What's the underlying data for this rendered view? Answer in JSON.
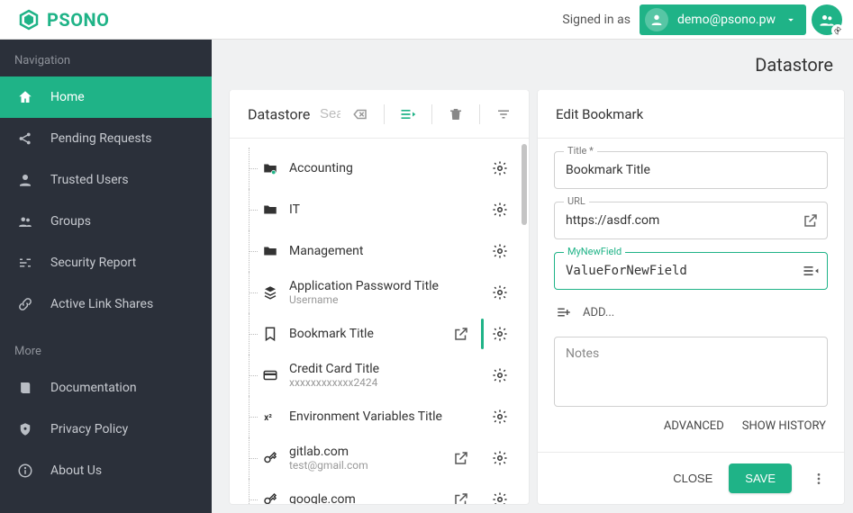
{
  "brand": {
    "name": "PSONO"
  },
  "header": {
    "signed_in_label": "Signed in as",
    "user_email": "demo@psono.pw"
  },
  "sidebar": {
    "heading_nav": "Navigation",
    "heading_more": "More",
    "nav": [
      {
        "label": "Home",
        "icon": "home",
        "active": true
      },
      {
        "label": "Pending Requests",
        "icon": "share"
      },
      {
        "label": "Trusted Users",
        "icon": "person"
      },
      {
        "label": "Groups",
        "icon": "group"
      },
      {
        "label": "Security Report",
        "icon": "equalizer"
      },
      {
        "label": "Active Link Shares",
        "icon": "link"
      }
    ],
    "more": [
      {
        "label": "Documentation",
        "icon": "book"
      },
      {
        "label": "Privacy Policy",
        "icon": "privacy"
      },
      {
        "label": "About Us",
        "icon": "info"
      }
    ]
  },
  "page": {
    "title": "Datastore"
  },
  "datastore": {
    "panel_title": "Datastore",
    "search_placeholder": "Search",
    "items": [
      {
        "title": "Accounting",
        "type": "folder-shared"
      },
      {
        "title": "IT",
        "type": "folder"
      },
      {
        "title": "Management",
        "type": "folder"
      },
      {
        "title": "Application Password Title",
        "subtitle": "Username",
        "type": "app"
      },
      {
        "title": "Bookmark Title",
        "type": "bookmark",
        "open_action": true,
        "selected": true
      },
      {
        "title": "Credit Card Title",
        "subtitle": "xxxxxxxxxxxx2424",
        "type": "card"
      },
      {
        "title": "Environment Variables Title",
        "type": "env"
      },
      {
        "title": "gitlab.com",
        "subtitle": "test@gmail.com",
        "type": "key",
        "open_action": true
      },
      {
        "title": "google.com",
        "type": "key",
        "open_action": true
      }
    ]
  },
  "editor": {
    "title": "Edit Bookmark",
    "fields": {
      "title_label": "Title *",
      "title_value": "Bookmark Title",
      "url_label": "URL",
      "url_value": "https://asdf.com",
      "custom_label": "MyNewField",
      "custom_value": "ValueForNewField"
    },
    "add_label": "ADD...",
    "notes_label": "Notes",
    "advanced_label": "ADVANCED",
    "history_label": "SHOW HISTORY",
    "close_label": "CLOSE",
    "save_label": "SAVE"
  }
}
